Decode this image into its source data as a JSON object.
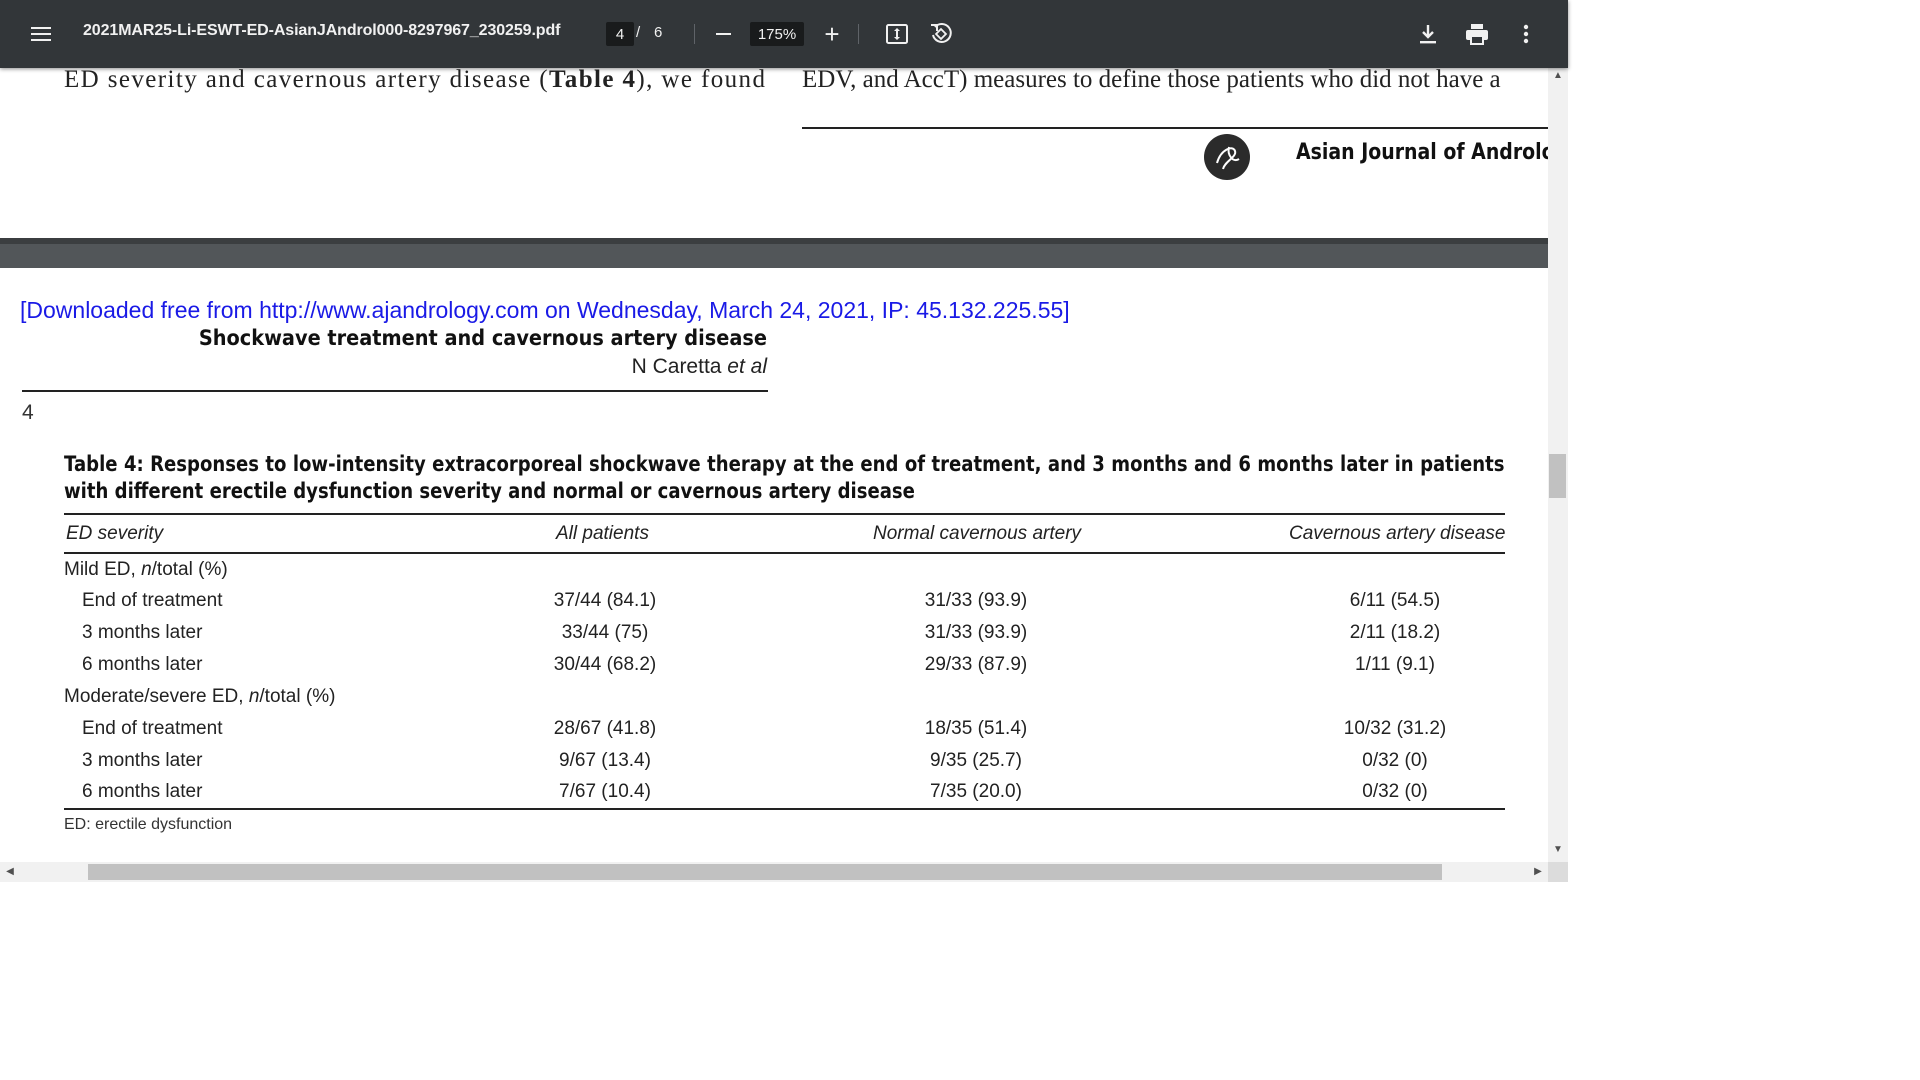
{
  "toolbar": {
    "filename": "2021MAR25-Li-ESWT-ED-AsianJAndrol000-8297967_230259.pdf",
    "current_page": "4",
    "page_separator": "/",
    "total_pages": "6",
    "zoom": "175%",
    "plus_label": "+",
    "icons": [
      "menu-icon",
      "minus-icon",
      "plus-icon",
      "fit-to-page-icon",
      "rotate-icon",
      "download-icon",
      "print-icon",
      "more-vert-icon"
    ]
  },
  "previous_page": {
    "left_fragment_a": "ED severity and cavernous artery disease (",
    "left_fragment_b": "Table 4",
    "left_fragment_c": "), we found",
    "right_fragment": "EDV, and AccT) measures to define those patients who did not have a",
    "journal_name": "Asian Journal of Andrology"
  },
  "current_page": {
    "download_note": "[Downloaded free from http://www.ajandrology.com on Wednesday, March 24, 2021, IP: 45.132.225.55]",
    "running_title": "Shockwave treatment and cavernous artery disease",
    "author_name": "N Caretta ",
    "author_etal": "et al",
    "page_number": "4",
    "table_caption": "Table 4: Responses to low-intensity extracorporeal shockwave therapy at the end of treatment, and 3 months and 6 months later in patients with different erectile dysfunction severity and normal or cavernous artery disease",
    "table": {
      "headers": [
        "ED severity",
        "All patients",
        "Normal cavernous artery",
        "Cavernous artery disease"
      ],
      "groups": [
        {
          "label_prefix": "Mild ED, ",
          "label_italic": "n",
          "label_suffix": "/total (%)",
          "rows": [
            {
              "label": "End of treatment",
              "all": "37/44 (84.1)",
              "normal": "31/33 (93.9)",
              "disease": "6/11 (54.5)"
            },
            {
              "label": "3 months later",
              "all": "33/44 (75)",
              "normal": "31/33 (93.9)",
              "disease": "2/11 (18.2)"
            },
            {
              "label": "6 months later",
              "all": "30/44 (68.2)",
              "normal": "29/33 (87.9)",
              "disease": "1/11 (9.1)"
            }
          ]
        },
        {
          "label_prefix": "Moderate/severe ED, ",
          "label_italic": "n",
          "label_suffix": "/total (%)",
          "rows": [
            {
              "label": "End of treatment",
              "all": "28/67 (41.8)",
              "normal": "18/35 (51.4)",
              "disease": "10/32 (31.2)"
            },
            {
              "label": "3 months later",
              "all": "9/67 (13.4)",
              "normal": "9/35 (25.7)",
              "disease": "0/32 (0)"
            },
            {
              "label": "6 months later",
              "all": "7/67 (10.4)",
              "normal": "7/35 (20.0)",
              "disease": "0/32 (0)"
            }
          ]
        }
      ],
      "footnote": "ED: erectile dysfunction"
    }
  },
  "colors": {
    "toolbar_bg": "#323639",
    "page_gap": "#525659",
    "download_note": "#1a1ae6"
  }
}
